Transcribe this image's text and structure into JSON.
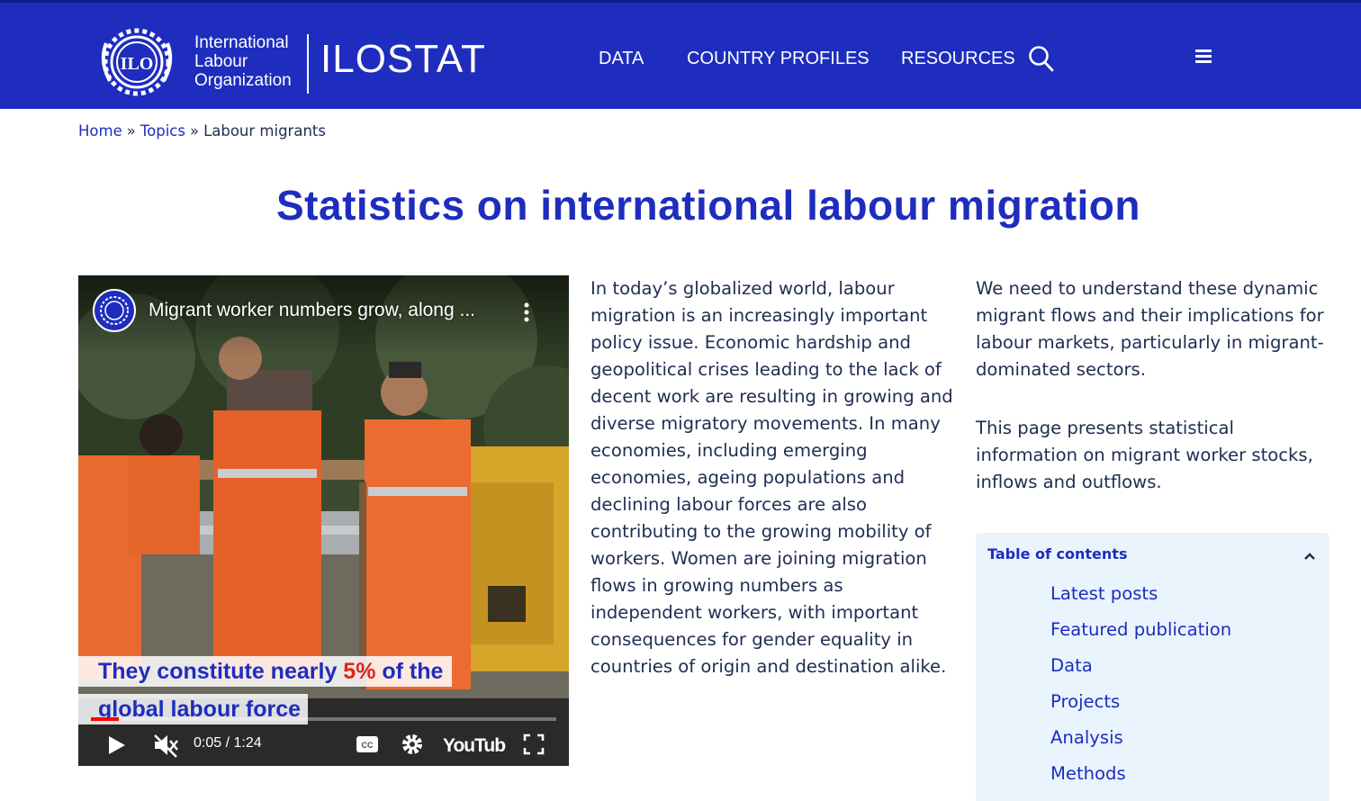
{
  "header": {
    "org_name_lines": [
      "International",
      "Labour",
      "Organization"
    ],
    "logo_emblem_text": "ILO",
    "brand": "ILOSTAT",
    "nav": [
      "DATA",
      "COUNTRY PROFILES",
      "RESOURCES"
    ],
    "search_icon": "search-icon",
    "menu_icon": "hamburger-menu-icon"
  },
  "breadcrumb": {
    "items": [
      "Home",
      "Topics"
    ],
    "separator": "»",
    "current": "Labour migrants"
  },
  "page_title": "Statistics on international labour migration",
  "video": {
    "title": "Migrant worker numbers grow, along ...",
    "caption_line1_before": "They constitute nearly ",
    "caption_line1_highlight": "5%",
    "caption_line1_after": " of the",
    "caption_line2": "global labour force",
    "time": "0:05 / 1:24",
    "progress": 0.06,
    "youtube_label": "YouTube",
    "icons": [
      "play-icon",
      "mute-icon",
      "captions-icon",
      "settings-gear-icon",
      "fullscreen-icon",
      "more-options-icon"
    ]
  },
  "intro_paragraph": "In today’s globalized world, labour migration is an increasingly important policy issue. Economic hardship and geopolitical crises leading to the lack of decent work are resulting in growing and diverse migratory movements. In many economies, including emerging economies, ageing populations and declining labour forces are also contributing to the growing mobility of workers. Women are joining migration flows in growing numbers as independent workers, with important consequences for gender equality in countries of origin and destination alike.",
  "right_paragraphs": [
    "We need to understand these dynamic migrant flows and their implications for labour markets, particularly in migrant-dominated sectors.",
    "This page presents statistical information on migrant worker stocks, inflows and outflows."
  ],
  "toc": {
    "header": "Table of contents",
    "items": [
      "Latest posts",
      "Featured publication",
      "Data",
      "Projects",
      "Analysis",
      "Methods"
    ]
  },
  "colors": {
    "brand_blue": "#1e2dbe",
    "body_text": "#1e2d52",
    "toc_background": "#eaf4fd",
    "caption_accent": "#e0241b"
  }
}
